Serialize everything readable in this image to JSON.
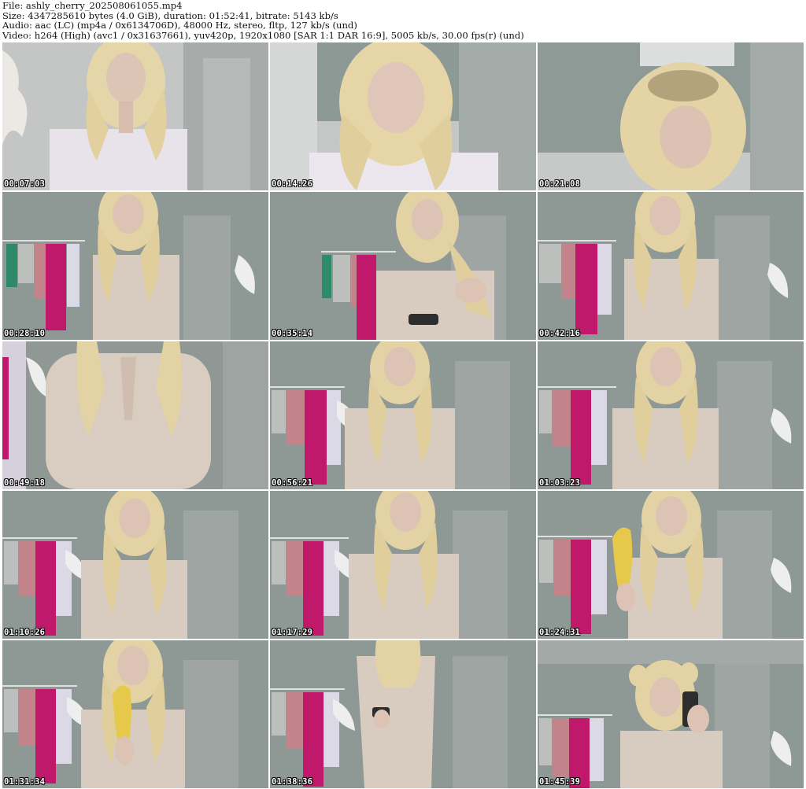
{
  "header": {
    "file_line": "File: ashly_cherry_202508061055.mp4",
    "size_line": "Size: 4347285610 bytes (4.0 GiB), duration: 01:52:41, bitrate: 5143 kb/s",
    "audio_line": "Audio: aac (LC) (mp4a / 0x6134706D), 48000 Hz, stereo, fltp, 127 kb/s (und)",
    "video_line": "Video: h264 (High) (avc1 / 0x31637661), yuv420p, 1920x1080 [SAR 1:1 DAR 16:9], 5005 kb/s, 30.00 fps(r) (und)"
  },
  "colors": {
    "wall": "#8d9893",
    "door": "#9aa09c",
    "hair": "#e3d3a4",
    "skin": "#dcc3b4",
    "top_white": "#e6e0e8",
    "top_beige": "#d8cbbf",
    "rack_pink": "#c0186a",
    "banana": "#e6c94a"
  },
  "thumbnails": [
    {
      "time": "00:07:03"
    },
    {
      "time": "00:14:26"
    },
    {
      "time": "00:21:08"
    },
    {
      "time": "00:28:10"
    },
    {
      "time": "00:35:14"
    },
    {
      "time": "00:42:16"
    },
    {
      "time": "00:49:18"
    },
    {
      "time": "00:56:21"
    },
    {
      "time": "01:03:23"
    },
    {
      "time": "01:10:26"
    },
    {
      "time": "01:17:29"
    },
    {
      "time": "01:24:31"
    },
    {
      "time": "01:31:34"
    },
    {
      "time": "01:38:36"
    },
    {
      "time": "01:45:39"
    }
  ]
}
